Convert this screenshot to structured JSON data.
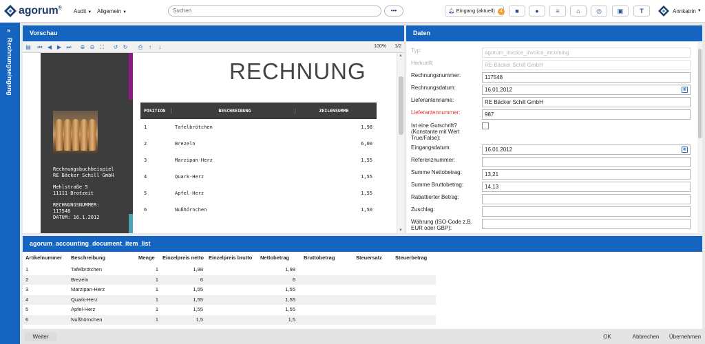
{
  "topbar": {
    "logo_text": "agorum",
    "logo_reg": "®",
    "menus": [
      "Audit",
      "Allgemein"
    ],
    "search_placeholder": "Suchen",
    "search_more": "•••",
    "inbox_label": "Eingang (aktuell)",
    "inbox_count": "4",
    "user": "Annkatrin"
  },
  "sidebar": {
    "collapse_icon": "»",
    "vertical_title": "Rechnungseingang"
  },
  "preview": {
    "title": "Vorschau",
    "zoom": "100%",
    "page": "1/2",
    "doc_title": "RECHNUNG",
    "sender_line1": "Rechnungsbuchbeispiel",
    "sender_line2": "RE Bäcker Schill GmbH",
    "address_line1": "Mehlstraße 5",
    "address_line2": "11111 Brotzeit",
    "inv_no_label": "RECHNUNGSNUMMER:",
    "inv_no": "117548",
    "date_line": "DATUM: 16.1.2012",
    "table_headers": [
      "POSITION",
      "BESCHREIBUNG",
      "ZEILENSUMME"
    ],
    "table_rows": [
      {
        "pos": "1",
        "desc": "Tafelbrötchen",
        "sum": "1,98"
      },
      {
        "pos": "2",
        "desc": "Brezeln",
        "sum": "6,00"
      },
      {
        "pos": "3",
        "desc": "Marzipan-Herz",
        "sum": "1,55"
      },
      {
        "pos": "4",
        "desc": "Quark-Herz",
        "sum": "1,55"
      },
      {
        "pos": "5",
        "desc": "Apfel-Herz",
        "sum": "1,55"
      },
      {
        "pos": "6",
        "desc": "Nußhörnchen",
        "sum": "1,50"
      }
    ]
  },
  "data_panel": {
    "title": "Daten",
    "fields": [
      {
        "label": "Typ:",
        "value": "agorum_invoice_invoice_incoming",
        "style": "dim"
      },
      {
        "label": "Herkunft:",
        "value": "RE Bäcker Schill GmbH",
        "style": "dim"
      },
      {
        "label": "Rechnungsnummer:",
        "value": "117548",
        "style": "normal"
      },
      {
        "label": "Rechnungsdatum:",
        "value": "16.01.2012",
        "style": "date"
      },
      {
        "label": "Lieferantenname:",
        "value": "RE Bäcker Schill GmbH",
        "style": "normal"
      },
      {
        "label": "Lieferantennummer:",
        "value": "987",
        "style": "required"
      },
      {
        "label": "Ist eine Gutschrift? (Konstante mit Wert True/False):",
        "value": "",
        "style": "checkbox"
      },
      {
        "label": "Eingangsdatum:",
        "value": "16.01.2012",
        "style": "date"
      },
      {
        "label": "Referenznummer:",
        "value": "",
        "style": "normal"
      },
      {
        "label": "Summe Nettobetrag:",
        "value": "13,21",
        "style": "normal"
      },
      {
        "label": "Summe Bruttobetrag:",
        "value": "14,13",
        "style": "normal"
      },
      {
        "label": "Rabattierter Betrag:",
        "value": "",
        "style": "normal"
      },
      {
        "label": "Zuschlag:",
        "value": "",
        "style": "normal"
      },
      {
        "label": "Währung (ISO-Code z.B. EUR oder GBP):",
        "value": "",
        "style": "normal"
      }
    ]
  },
  "item_list": {
    "title": "agorum_accounting_document_item_list",
    "columns": [
      "Artikelnummer",
      "Beschreibung",
      "Menge",
      "Einzelpreis netto",
      "Einzelpreis brutto",
      "Nettobetrag",
      "Bruttobetrag",
      "Steuersatz",
      "Steuerbetrag"
    ],
    "rows": [
      {
        "nr": "1",
        "desc": "Tafelbrötchen",
        "qty": "1",
        "net": "1,98",
        "gross": "",
        "netamt": "1,98"
      },
      {
        "nr": "2",
        "desc": "Brezeln",
        "qty": "1",
        "net": "6",
        "gross": "",
        "netamt": "6"
      },
      {
        "nr": "3",
        "desc": "Marzipan-Herz",
        "qty": "1",
        "net": "1,55",
        "gross": "",
        "netamt": "1,55"
      },
      {
        "nr": "4",
        "desc": "Quark-Herz",
        "qty": "1",
        "net": "1,55",
        "gross": "",
        "netamt": "1,55"
      },
      {
        "nr": "5",
        "desc": "Apfel-Herz",
        "qty": "1",
        "net": "1,55",
        "gross": "",
        "netamt": "1,55"
      },
      {
        "nr": "6",
        "desc": "Nußhörnchen",
        "qty": "1",
        "net": "1,5",
        "gross": "",
        "netamt": "1,5"
      }
    ]
  },
  "footer": {
    "next": "Weiter",
    "ok": "OK",
    "cancel": "Abbrechen",
    "apply": "Übernehmen"
  },
  "colors": {
    "primary": "#1565c0",
    "brand": "#1f3b66",
    "badge": "#f0a02c",
    "required": "#dd3333"
  }
}
